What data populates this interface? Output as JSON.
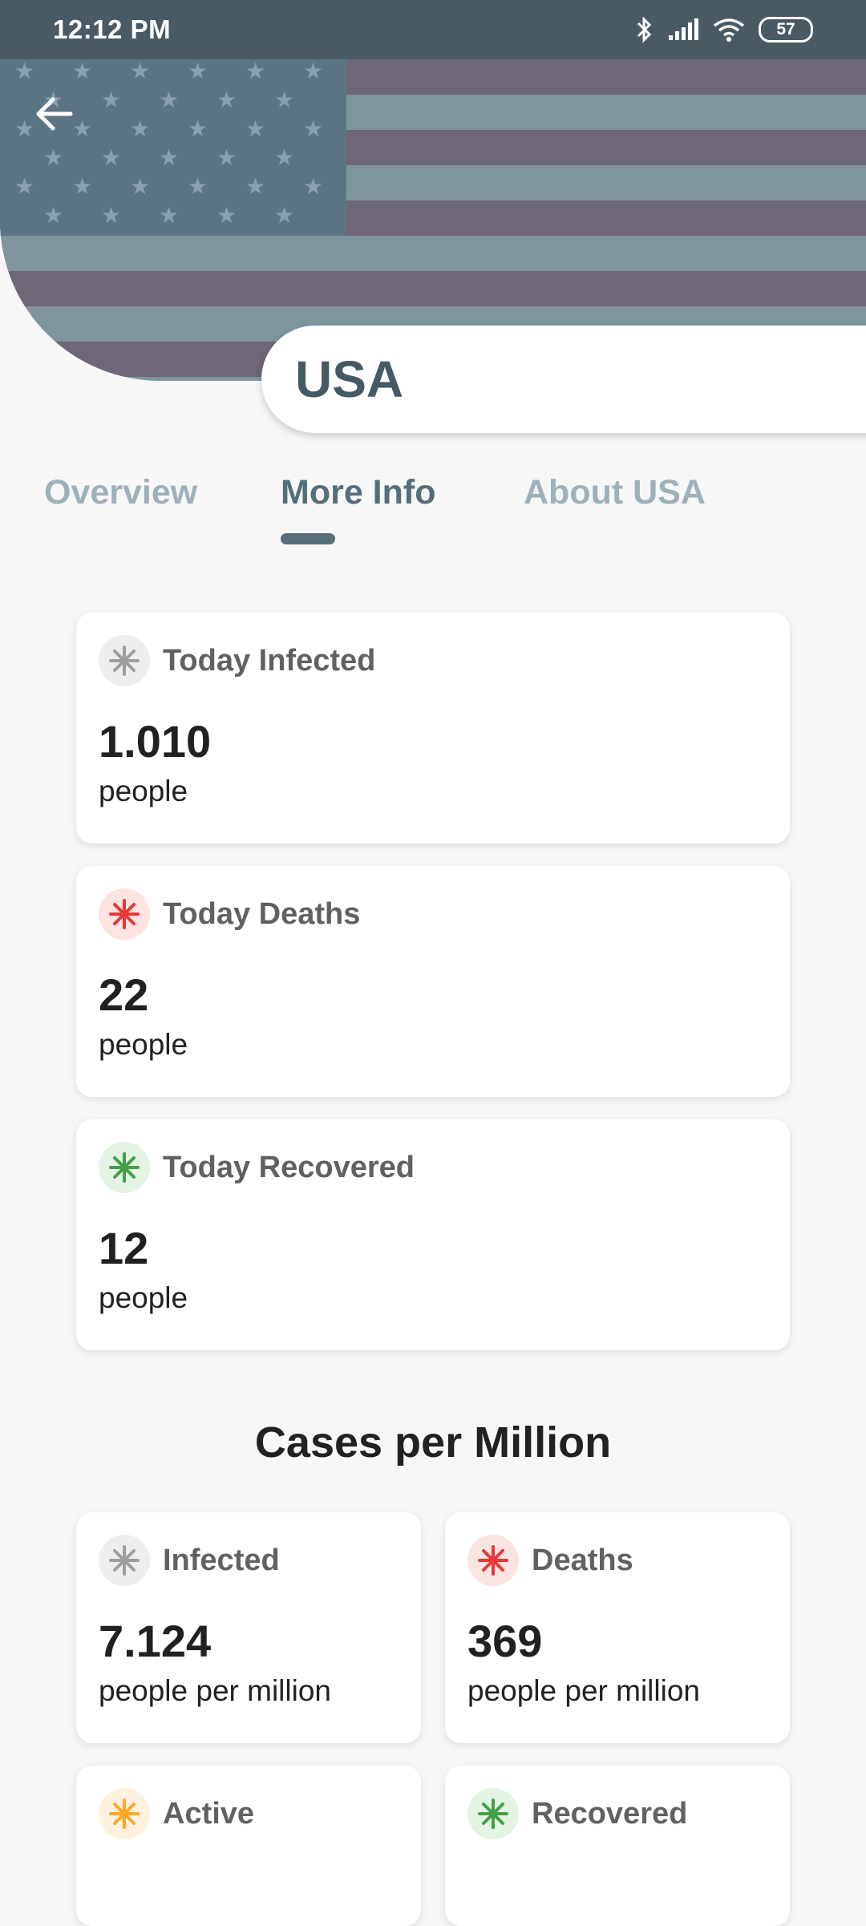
{
  "status_bar": {
    "time": "12:12 PM",
    "battery": "57"
  },
  "header": {
    "country": "USA"
  },
  "tabs": [
    {
      "label": "Overview"
    },
    {
      "label": "More Info"
    },
    {
      "label": "About USA"
    }
  ],
  "today_cards": [
    {
      "label": "Today Infected",
      "value": "1.010",
      "unit": "people",
      "icon": "virus-icon",
      "color": "#9e9e9e"
    },
    {
      "label": "Today Deaths",
      "value": "22",
      "unit": "people",
      "icon": "virus-icon",
      "color": "#e53935"
    },
    {
      "label": "Today Recovered",
      "value": "12",
      "unit": "people",
      "icon": "virus-icon",
      "color": "#43a047"
    }
  ],
  "section": {
    "title": "Cases per Million"
  },
  "per_million": [
    {
      "label": "Infected",
      "value": "7.124",
      "unit": "people per million",
      "color": "#9e9e9e"
    },
    {
      "label": "Deaths",
      "value": "369",
      "unit": "people per million",
      "color": "#e53935"
    },
    {
      "label": "Active",
      "color": "#ffa726"
    },
    {
      "label": "Recovered",
      "color": "#43a047"
    }
  ]
}
